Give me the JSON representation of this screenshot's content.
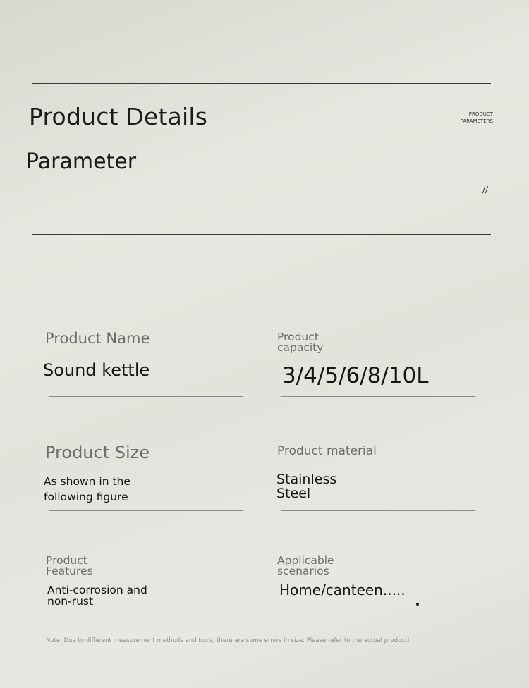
{
  "header": {
    "title": "Product Details",
    "subtitle": "Parameter",
    "side_label_line1": "PRODUCT",
    "side_label_line2": "PARAMETERS",
    "slash": "//"
  },
  "params": {
    "name_label": "Product Name",
    "name_value": "Sound kettle",
    "capacity_label_1": "Product",
    "capacity_label_2": "capacity",
    "capacity_value": "3/4/5/6/8/10L",
    "size_label": "Product Size",
    "size_value_1": "As shown in the",
    "size_value_2": "following figure",
    "material_label": "Product material",
    "material_value_1": "Stainless",
    "material_value_2": "Steel",
    "features_label_1": "Product",
    "features_label_2": "Features",
    "features_value_1": "Anti-corrosion and",
    "features_value_2": "non-rust",
    "scenarios_label_1": "Applicable",
    "scenarios_label_2": "scenarios",
    "scenarios_value": "Home/canteen....."
  },
  "note": "Note: Due to different measurement methods and tools, there are some errors in size. Please refer to the actual product!"
}
